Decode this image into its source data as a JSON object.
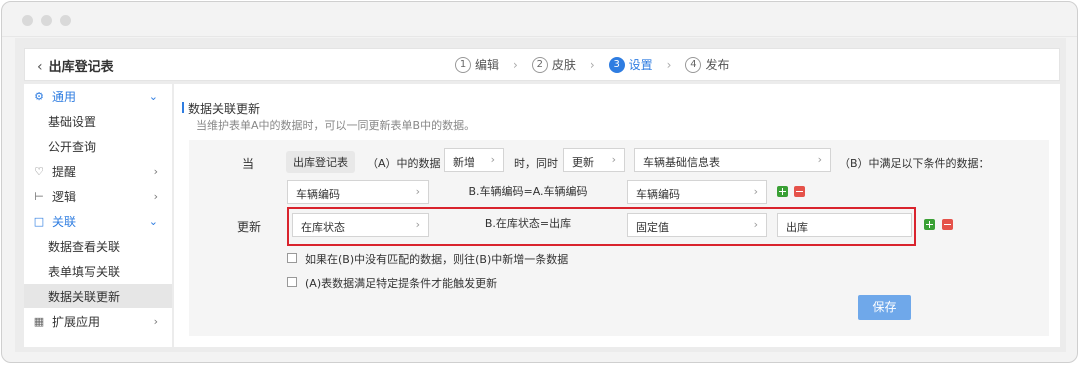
{
  "header": {
    "back_title": "出库登记表"
  },
  "steps": [
    {
      "num": "1",
      "label": "编辑"
    },
    {
      "num": "2",
      "label": "皮肤"
    },
    {
      "num": "3",
      "label": "设置"
    },
    {
      "num": "4",
      "label": "发布"
    }
  ],
  "sidebar": {
    "items": [
      {
        "label": "通用"
      },
      {
        "label": "基础设置"
      },
      {
        "label": "公开查询"
      },
      {
        "label": "提醒"
      },
      {
        "label": "逻辑"
      },
      {
        "label": "关联"
      },
      {
        "label": "数据查看关联"
      },
      {
        "label": "表单填写关联"
      },
      {
        "label": "数据关联更新"
      },
      {
        "label": "扩展应用"
      }
    ]
  },
  "main": {
    "title": "数据关联更新",
    "desc": "当维护表单A中的数据时，可以一同更新表单B中的数据。",
    "when_label": "当",
    "update_label": "更新",
    "form_a_tag": "出库登记表",
    "text_a_data": "（A）中的数据",
    "action_select": "新增",
    "text_then": "时，同时",
    "op_select": "更新",
    "form_b_select": "车辆基础信息表",
    "text_b_cond": "（B）中满足以下条件的数据：",
    "cond_left": "车辆编码",
    "cond_expr": "B.车辆编码=A.车辆编码",
    "cond_right": "车辆编码",
    "upd_left": "在库状态",
    "upd_expr": "B.在库状态=出库",
    "upd_type": "固定值",
    "upd_value": "出库",
    "check1": "如果在(B)中没有匹配的数据，则往(B)中新增一条数据",
    "check2": "(A)表数据满足特定提条件才能触发更新",
    "save": "保存"
  },
  "colors": {
    "accent": "#2f7de1",
    "highlight_border": "#d9232d",
    "save_button": "#6fa8ea"
  }
}
